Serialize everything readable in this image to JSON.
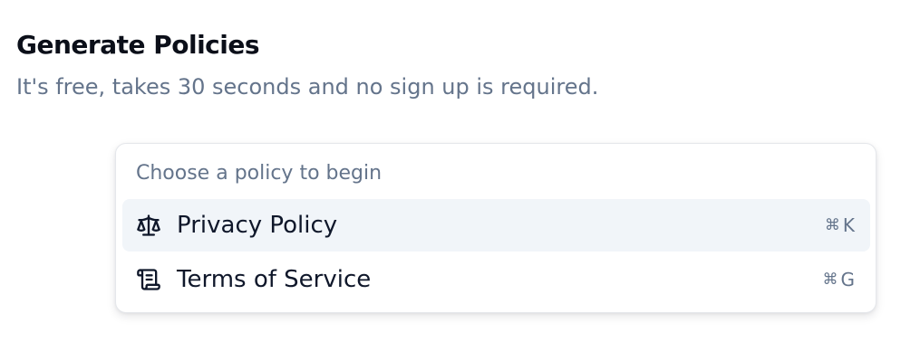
{
  "header": {
    "title": "Generate Policies",
    "subtitle": "It's free, takes 30 seconds and no sign up is required."
  },
  "menu": {
    "heading": "Choose a policy to begin",
    "items": [
      {
        "label": "Privacy Policy",
        "icon": "scale-icon",
        "shortcut_symbol": "⌘",
        "shortcut_key": "K",
        "active": true
      },
      {
        "label": "Terms of Service",
        "icon": "scroll-icon",
        "shortcut_symbol": "⌘",
        "shortcut_key": "G",
        "active": false
      }
    ]
  },
  "colors": {
    "title": "#0b0f19",
    "muted_text": "#64748b",
    "active_item_bg": "#f1f5f9",
    "border": "#e5e7eb"
  }
}
